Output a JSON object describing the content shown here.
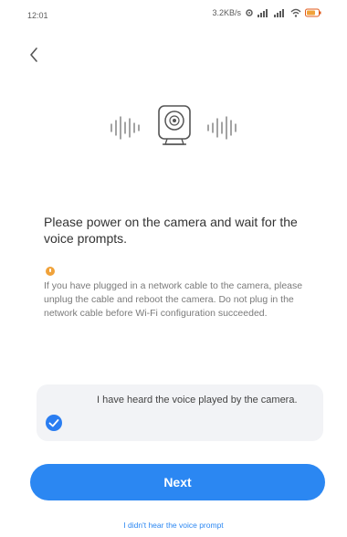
{
  "status_bar": {
    "time": "12:01",
    "speed": "3.2KB/s",
    "icons": [
      "settings-icon",
      "cellular-signal-icon",
      "cellular-signal-icon",
      "wifi-icon",
      "battery-icon"
    ],
    "accent": "#5a5a5a"
  },
  "nav": {
    "back_icon": "chevron-left-icon"
  },
  "hero": {
    "icon": "camera-icon",
    "sound_waves": "sound-wave-icon"
  },
  "content": {
    "instruction": "Please power on the camera and wait for the voice prompts.",
    "warning_icon": "warning-icon",
    "warning": "If you have plugged in a network cable to the camera, please unplug the cable and reboot the camera. Do not plug in the network cable before Wi-Fi configuration succeeded."
  },
  "confirm": {
    "label": "I have heard the voice played by the camera.",
    "checked": true
  },
  "actions": {
    "next_label": "Next",
    "link_label": "I didn't hear the voice prompt"
  },
  "colors": {
    "primary": "#2b87f2",
    "card_bg": "#f2f3f6",
    "warning": "#f0a23a"
  }
}
